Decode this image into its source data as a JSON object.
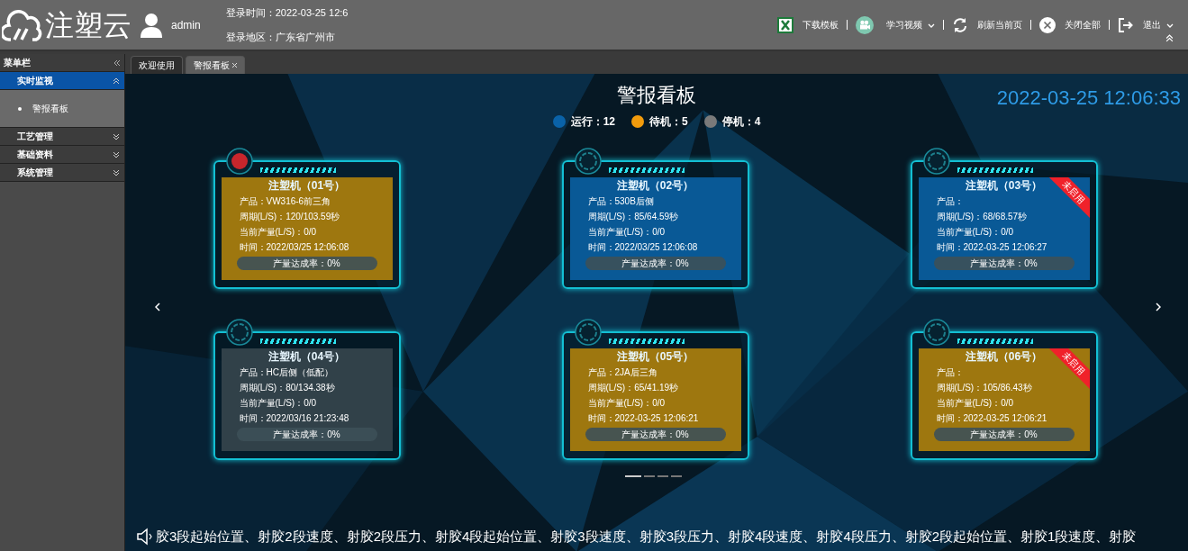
{
  "header": {
    "logo": "注塑云",
    "user": "admin",
    "login_time": "登录时间：2022-03-25 12:6",
    "login_region": "登录地区：广东省广州市",
    "actions": [
      {
        "kind": "excel",
        "label": "下载模板",
        "dropdown": false
      },
      {
        "kind": "video",
        "label": "学习视频",
        "dropdown": true
      },
      {
        "kind": "refresh",
        "label": "刷新当前页",
        "dropdown": false
      },
      {
        "kind": "close",
        "label": "关闭全部",
        "dropdown": false
      },
      {
        "kind": "logout",
        "label": "退出",
        "dropdown": true
      }
    ]
  },
  "sidebar": {
    "title": "菜单栏",
    "groups": [
      {
        "label": "实时监视",
        "expanded": true,
        "children": [
          {
            "label": "警报看板"
          }
        ]
      },
      {
        "label": "工艺管理",
        "expanded": false
      },
      {
        "label": "基础资料",
        "expanded": false
      },
      {
        "label": "系统管理",
        "expanded": false
      }
    ]
  },
  "tabs": [
    {
      "label": "欢迎使用",
      "selected": false
    },
    {
      "label": "警报看板",
      "selected": true,
      "closable": true
    }
  ],
  "board": {
    "title": "警报看板",
    "clock": "2022-03-25 12:06:33",
    "legend": [
      {
        "label": "运行：12",
        "color": "#0a62a8"
      },
      {
        "label": "待机：5",
        "color": "#f29b0c"
      },
      {
        "label": "停机：4",
        "color": "#7a7a7a"
      }
    ],
    "machines": [
      {
        "name": "注塑机（01号）",
        "kind": "standby",
        "alarm": true,
        "product": "产品：VW316-6前三角",
        "cycle": "周期(L/S)：120/103.59秒",
        "output": "当前产量(L/S)：0/0",
        "time": "时间：2022/03/25 12:06:08",
        "rate": "产量达成率：0%"
      },
      {
        "name": "注塑机（02号）",
        "kind": "running",
        "alarm": false,
        "product": "产品：530B后侧",
        "cycle": "周期(L/S)：85/64.59秒",
        "output": "当前产量(L/S)：0/0",
        "time": "时间：2022/03/25 12:06:08",
        "rate": "产量达成率：0%"
      },
      {
        "name": "注塑机（03号）",
        "kind": "running",
        "alarm": false,
        "ribbon": "未启用",
        "product": "产品：",
        "cycle": "周期(L/S)：68/68.57秒",
        "output": "当前产量(L/S)：0/0",
        "time": "时间：2022-03-25 12:06:27",
        "rate": "产量达成率：0%"
      },
      {
        "name": "注塑机（04号）",
        "kind": "stopped",
        "alarm": false,
        "product": "产品：HC后侧（低配）",
        "cycle": "周期(L/S)：80/134.38秒",
        "output": "当前产量(L/S)：0/0",
        "time": "时间：2022/03/16 21:23:48",
        "rate": "产量达成率：0%"
      },
      {
        "name": "注塑机（05号）",
        "kind": "standby",
        "alarm": false,
        "product": "产品：2JA后三角",
        "cycle": "周期(L/S)：65/41.19秒",
        "output": "当前产量(L/S)：0/0",
        "time": "时间：2022-03-25 12:06:21",
        "rate": "产量达成率：0%"
      },
      {
        "name": "注塑机（06号）",
        "kind": "standby",
        "alarm": false,
        "ribbon": "未启用",
        "product": "产品：",
        "cycle": "周期(L/S)：105/86.43秒",
        "output": "当前产量(L/S)：0/0",
        "time": "时间：2022-03-25 12:06:21",
        "rate": "产量达成率：0%"
      }
    ],
    "pager": [
      {
        "selected": true
      },
      {
        "selected": false
      },
      {
        "selected": false
      },
      {
        "selected": false
      }
    ],
    "marquee": "胶3段起始位置、射胶2段速度、射胶2段压力、射胶4段起始位置、射胶3段速度、射胶3段压力、射胶4段速度、射胶4段压力、射胶2段起始位置、射胶1段速度、射胶"
  }
}
